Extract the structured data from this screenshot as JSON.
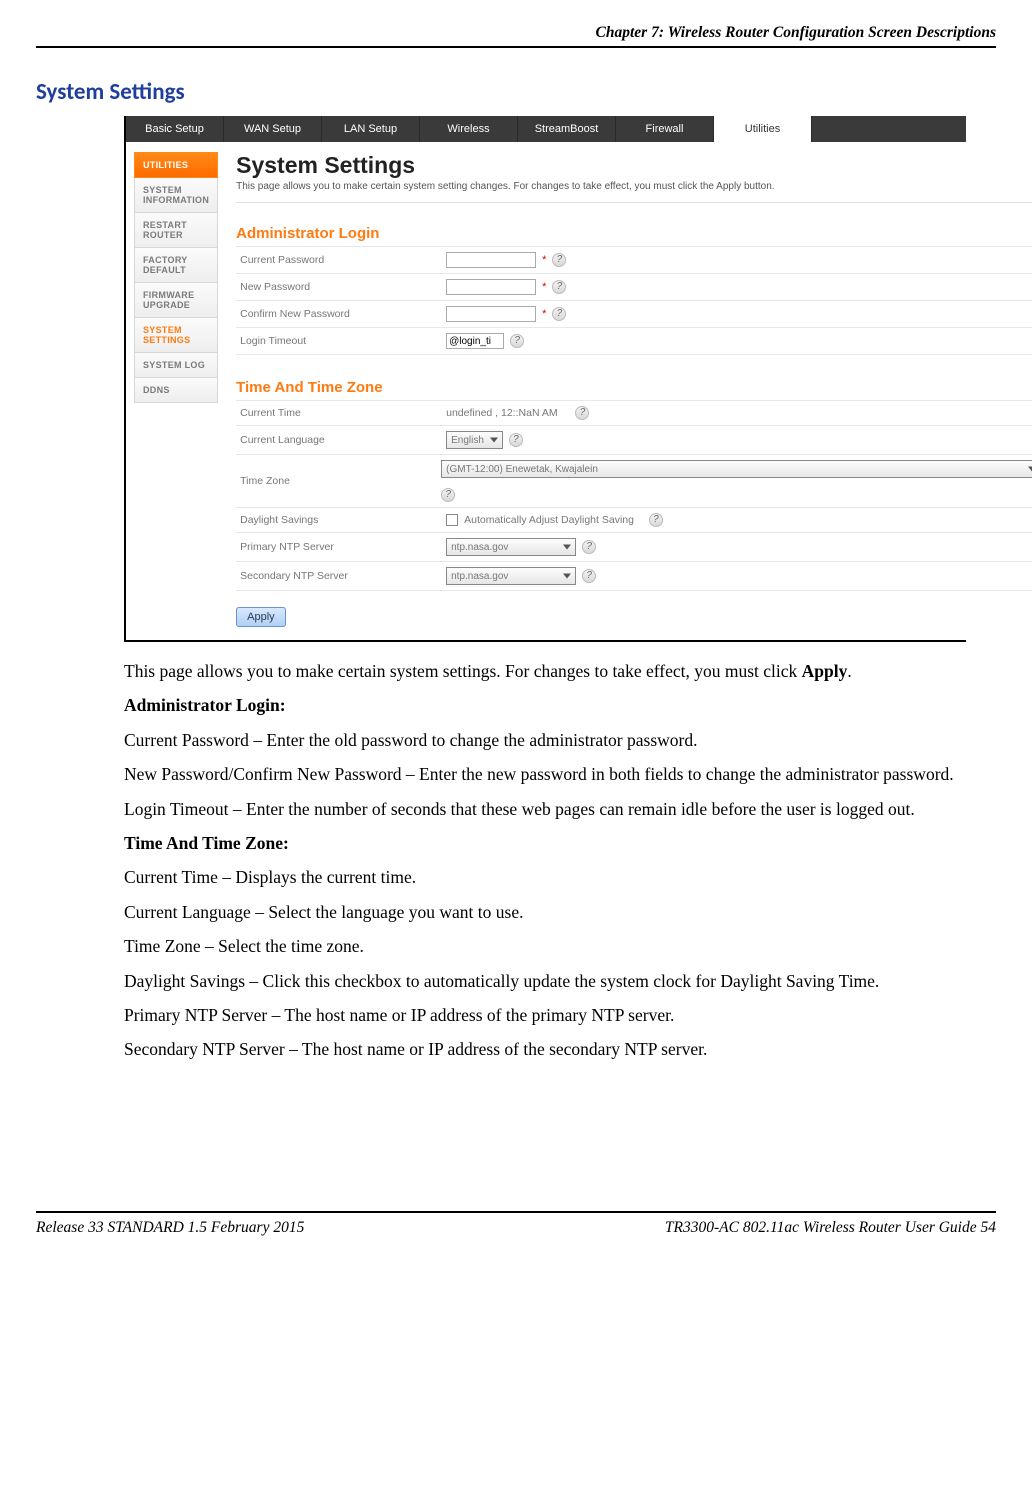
{
  "header": {
    "chapter_line": "Chapter 7: Wireless Router Configuration Screen Descriptions"
  },
  "section_title": "System Settings",
  "screenshot": {
    "tabs": {
      "basic_setup": "Basic Setup",
      "wan_setup": "WAN Setup",
      "lan_setup": "LAN Setup",
      "wireless": "Wireless",
      "streamboost": "StreamBoost",
      "firewall": "Firewall",
      "utilities": "Utilities"
    },
    "sidebar": {
      "utilities": "UTILITIES",
      "system_information": "SYSTEM INFORMATION",
      "restart_router": "RESTART ROUTER",
      "factory_default": "FACTORY DEFAULT",
      "firmware_upgrade": "FIRMWARE UPGRADE",
      "system_settings": "SYSTEM SETTINGS",
      "system_log": "SYSTEM LOG",
      "ddns": "DDNS"
    },
    "main": {
      "title": "System Settings",
      "intro": "This page allows you to make certain system setting changes. For changes to take effect, you must click the Apply button.",
      "admin_heading": "Administrator Login",
      "current_password": "Current Password",
      "new_password": "New Password",
      "confirm_new_password": "Confirm New Password",
      "login_timeout": "Login Timeout",
      "login_timeout_value": "@login_ti",
      "time_heading": "Time And Time Zone",
      "current_time": "Current Time",
      "current_time_value": "undefined ,   12::NaN AM",
      "current_language": "Current Language",
      "current_language_value": "English",
      "time_zone": "Time Zone",
      "time_zone_value": "(GMT-12:00) Enewetak, Kwajalein",
      "daylight_savings": "Daylight Savings",
      "daylight_label": "Automatically Adjust Daylight Saving",
      "primary_ntp": "Primary NTP Server",
      "secondary_ntp": "Secondary NTP Server",
      "ntp_value": "ntp.nasa.gov",
      "apply_label": "Apply"
    }
  },
  "body": {
    "p1a": "This page allows you to make certain system settings.  For changes to take effect, you must click ",
    "p1b": "Apply",
    "p1c": ".",
    "h_admin": "Administrator Login:",
    "p2": "Current Password – Enter the old password to change the administrator password.",
    "p3": "New Password/Confirm New Password –  Enter the new password in both fields to change the administrator password.",
    "p4": "Login Timeout – Enter the number of seconds that these web pages can remain idle before the user is logged out.",
    "h_time": "Time And Time Zone:",
    "p5": "Current Time – Displays the current time.",
    "p6": "Current Language –  Select the language you want to use.",
    "p7": "Time Zone – Select the time zone.",
    "p8": "Daylight Savings – Click this checkbox to automatically update the system clock for Daylight Saving Time.",
    "p9": "Primary NTP Server – The host name or IP address of the primary NTP server.",
    "p10": "Secondary NTP Server – The host name or IP address of the secondary NTP server."
  },
  "footer": {
    "left": "Release 33 STANDARD 1.5    February 2015",
    "right": "TR3300-AC 802.11ac Wireless Router User Guide    54"
  }
}
